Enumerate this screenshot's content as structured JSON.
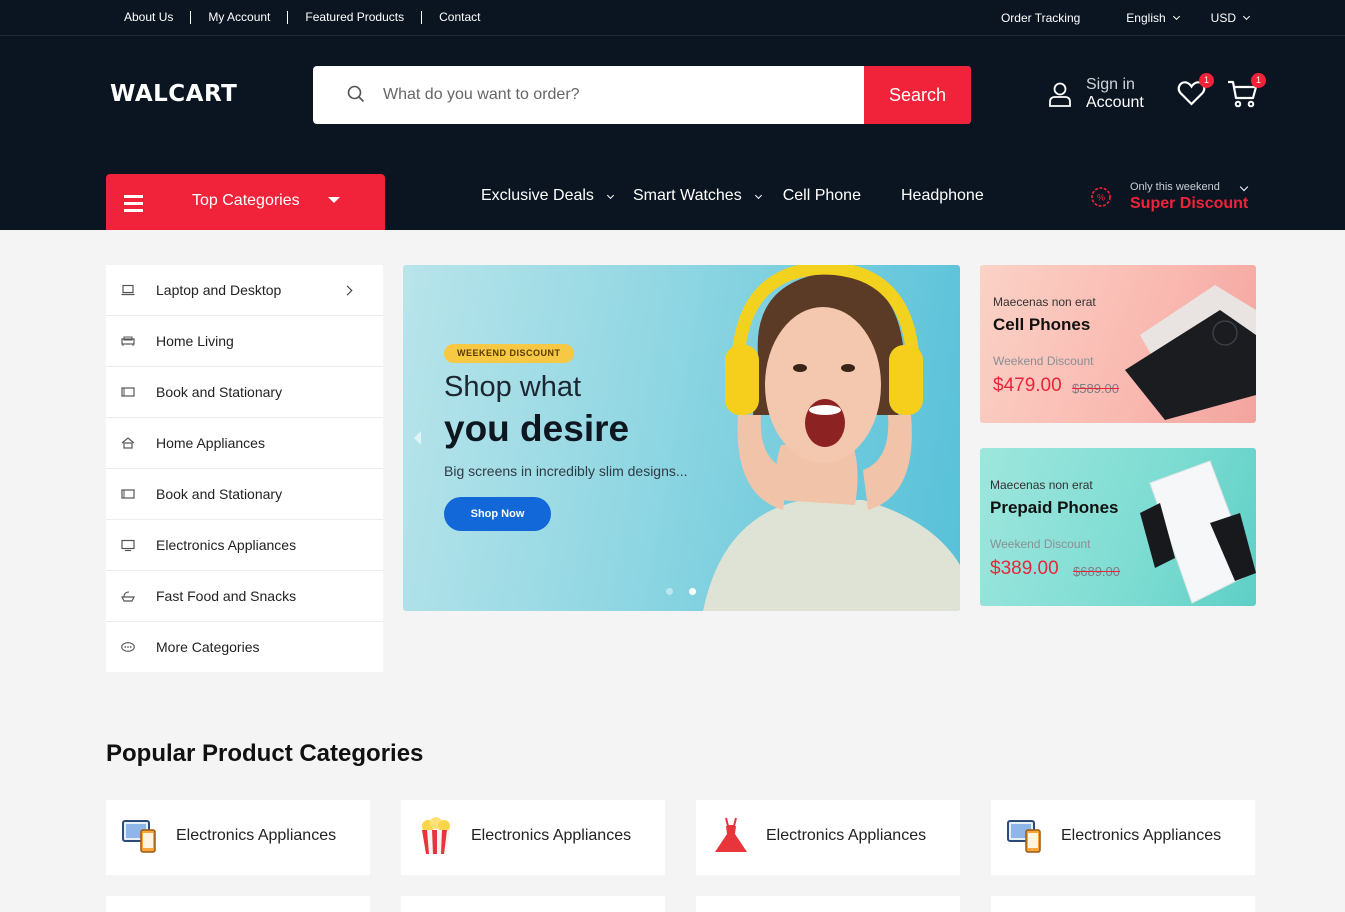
{
  "topbar": {
    "links": [
      "About Us",
      "My Account",
      "Featured Products",
      "Contact"
    ],
    "order_tracking": "Order Tracking",
    "language": "English",
    "currency": "USD"
  },
  "header": {
    "logo": "WALCART",
    "search_placeholder": "What do you want to order?",
    "search_button": "Search",
    "account_line1": "Sign in",
    "account_line2": "Account",
    "wishlist_count": "1",
    "cart_count": "1"
  },
  "categories_button": "Top Categories",
  "nav": [
    "Exclusive Deals",
    "Smart Watches",
    "Cell Phone",
    "Headphone"
  ],
  "promo": {
    "small": "Only this weekend",
    "big": "Super Discount"
  },
  "sidebar": [
    {
      "label": "Laptop and Desktop",
      "icon": "laptop-icon"
    },
    {
      "label": "Home Living",
      "icon": "sofa-icon"
    },
    {
      "label": "Book and Stationary",
      "icon": "book-icon"
    },
    {
      "label": "Home Appliances",
      "icon": "house-icon"
    },
    {
      "label": "Book and Stationary",
      "icon": "book-icon"
    },
    {
      "label": "Electronics Appliances",
      "icon": "monitor-icon"
    },
    {
      "label": "Fast Food and Snacks",
      "icon": "food-icon"
    },
    {
      "label": "More Categories",
      "icon": "more-icon"
    }
  ],
  "hero": {
    "tag": "WEEKEND DISCOUNT",
    "line1": "Shop what",
    "line2": "you desire",
    "desc": "Big screens in incredibly slim designs...",
    "button": "Shop Now"
  },
  "banners": [
    {
      "kicker": "Maecenas non erat",
      "title": "Cell Phones",
      "weekend": "Weekend Discount",
      "price": "$479.00",
      "old": "$589.00"
    },
    {
      "kicker": "Maecenas non erat",
      "title": "Prepaid Phones",
      "weekend": "Weekend Discount",
      "price": "$389.00",
      "old": "$689.00"
    }
  ],
  "popular": {
    "title": "Popular Product Categories",
    "cards": [
      {
        "label": "Electronics Appliances",
        "icon": "devices-icon"
      },
      {
        "label": "Electronics Appliances",
        "icon": "popcorn-icon"
      },
      {
        "label": "Electronics Appliances",
        "icon": "dress-icon"
      },
      {
        "label": "Electronics Appliances",
        "icon": "devices-icon"
      }
    ]
  },
  "colors": {
    "brand_red": "#f0233a",
    "dark_bg": "#0a1521",
    "hero_button": "#1267d9"
  }
}
